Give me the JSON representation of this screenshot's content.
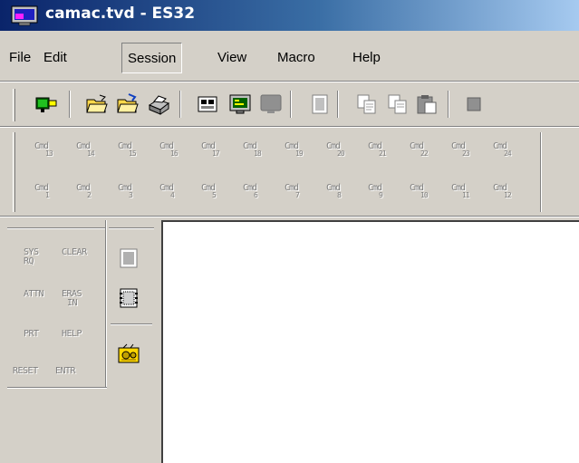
{
  "window": {
    "title": "camac.tvd - ES32"
  },
  "menu": {
    "items": [
      {
        "label": "File"
      },
      {
        "label": "Edit"
      },
      {
        "label": "Session"
      },
      {
        "label": "View"
      },
      {
        "label": "Macro"
      },
      {
        "label": "Help"
      }
    ]
  },
  "toolbar": {
    "icons": [
      "connect-icon",
      "open-folder-icon",
      "open-folder-alt-icon",
      "print-icon",
      "sessions-icon",
      "screen-icon",
      "monitor-off-icon",
      "screen-frame-icon",
      "copy-icon",
      "copy-disabled-icon",
      "paste-icon",
      "stop-icon"
    ]
  },
  "cmd_keys": {
    "row1": [
      {
        "k1": "Cmd",
        "k2": "13"
      },
      {
        "k1": "Cmd",
        "k2": "14"
      },
      {
        "k1": "Cmd",
        "k2": "15"
      },
      {
        "k1": "Cmd",
        "k2": "16"
      },
      {
        "k1": "Cmd",
        "k2": "17"
      },
      {
        "k1": "Cmd",
        "k2": "18"
      },
      {
        "k1": "Cmd",
        "k2": "19"
      },
      {
        "k1": "Cmd",
        "k2": "20"
      },
      {
        "k1": "Cmd",
        "k2": "21"
      },
      {
        "k1": "Cmd",
        "k2": "22"
      },
      {
        "k1": "Cmd",
        "k2": "23"
      },
      {
        "k1": "Cmd",
        "k2": "24"
      }
    ],
    "row2": [
      {
        "k1": "Cmd",
        "k2": "1"
      },
      {
        "k1": "Cmd",
        "k2": "2"
      },
      {
        "k1": "Cmd",
        "k2": "3"
      },
      {
        "k1": "Cmd",
        "k2": "4"
      },
      {
        "k1": "Cmd",
        "k2": "5"
      },
      {
        "k1": "Cmd",
        "k2": "6"
      },
      {
        "k1": "Cmd",
        "k2": "7"
      },
      {
        "k1": "Cmd",
        "k2": "8"
      },
      {
        "k1": "Cmd",
        "k2": "9"
      },
      {
        "k1": "Cmd",
        "k2": "10"
      },
      {
        "k1": "Cmd",
        "k2": "11"
      },
      {
        "k1": "Cmd",
        "k2": "12"
      }
    ]
  },
  "keypad": {
    "sys_rq": [
      "SYS",
      "RQ"
    ],
    "clear": "CLEAR",
    "attn": "ATTN",
    "eras_in": [
      "ERAS",
      "IN"
    ],
    "prt": "PRT",
    "help": "HELP",
    "reset": "RESET",
    "entr": "ENTR"
  },
  "colors": {
    "face": "#d4d0c8",
    "titlebar_start": "#0a246a",
    "titlebar_end": "#a6caf0",
    "client": "#ffffff"
  }
}
